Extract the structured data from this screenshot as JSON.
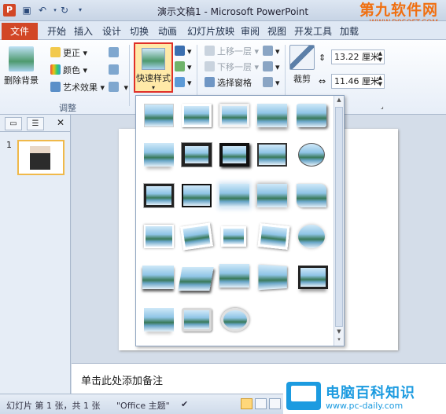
{
  "window": {
    "title": "演示文稿1 - Microsoft PowerPoint",
    "app_icon": "P"
  },
  "watermark_top": {
    "cn": "第九软件网",
    "en": "WWW.D9SOFT.COM"
  },
  "tabs": {
    "file": "文件",
    "items": [
      "开始",
      "插入",
      "设计",
      "切换",
      "动画",
      "幻灯片放映",
      "审阅",
      "视图",
      "开发工具",
      "加载"
    ]
  },
  "ribbon": {
    "remove_bg": "删除背景",
    "corrections": "更正",
    "color": "颜色",
    "artistic_effects": "艺术效果",
    "adjust_group": "调整",
    "quick_styles": "快速样式",
    "bring_forward": "上移一层",
    "send_backward": "下移一层",
    "selection_pane": "选择窗格",
    "crop": "裁剪",
    "height": "13.22 厘米",
    "width": "11.46 厘米"
  },
  "left_pane": {
    "slide_number": "1"
  },
  "gallery": {
    "rows": 6,
    "thumbnails": 28
  },
  "notes": {
    "placeholder": "单击此处添加备注"
  },
  "status": {
    "slide_info": "幻灯片 第 1 张，共 1 张",
    "theme": "\"Office 主题\""
  },
  "watermark_bottom": {
    "cn": "电脑百科知识",
    "en": "www.pc-daily.com"
  },
  "colors": {
    "file_tab": "#d24726",
    "highlight_border": "#e03028",
    "selection_fill": "#ffe9a8",
    "watermark_orange": "#f06f10",
    "watermark_blue": "#1c9be0"
  }
}
